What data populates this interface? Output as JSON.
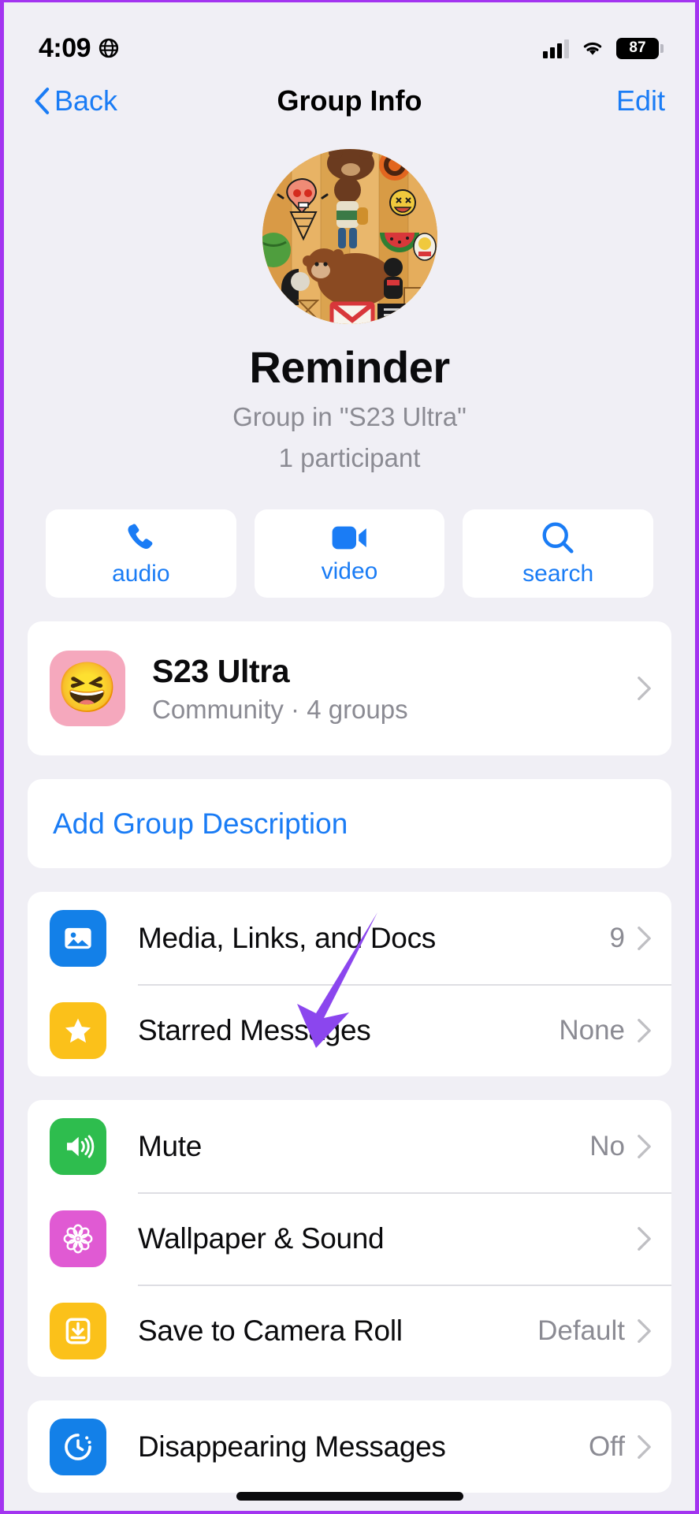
{
  "status_bar": {
    "time": "4:09",
    "location_icon": "globe-icon",
    "signal_icon": "cellular-signal-icon",
    "wifi_icon": "wifi-icon",
    "battery_level": "87"
  },
  "nav": {
    "back_label": "Back",
    "title": "Group Info",
    "edit_label": "Edit"
  },
  "profile": {
    "avatar_name": "group-avatar",
    "group_name": "Reminder",
    "parent_community": "Group in \"S23 Ultra\"",
    "participants": "1 participant"
  },
  "actions": [
    {
      "label": "audio",
      "icon": "phone-icon"
    },
    {
      "label": "video",
      "icon": "video-camera-icon"
    },
    {
      "label": "search",
      "icon": "search-icon"
    }
  ],
  "community": {
    "emoji": "😆",
    "title": "S23 Ultra",
    "subtitle": "Community · 4 groups",
    "icon_bg": "#f5a8bd"
  },
  "description": {
    "label": "Add Group Description"
  },
  "media_section": [
    {
      "label": "Media, Links, and Docs",
      "value": "9",
      "icon": "photo-icon",
      "icon_bg": "#1380e8"
    },
    {
      "label": "Starred Messages",
      "value": "None",
      "icon": "star-icon",
      "icon_bg": "#fbc11a"
    }
  ],
  "settings_section": [
    {
      "label": "Mute",
      "value": "No",
      "icon": "speaker-icon",
      "icon_bg": "#2ebd4e"
    },
    {
      "label": "Wallpaper & Sound",
      "value": "",
      "icon": "flower-icon",
      "icon_bg": "#e05ad3"
    },
    {
      "label": "Save to Camera Roll",
      "value": "Default",
      "icon": "download-icon",
      "icon_bg": "#fbc11a"
    }
  ],
  "privacy_section": [
    {
      "label": "Disappearing Messages",
      "value": "Off",
      "icon": "timer-icon",
      "icon_bg": "#1380e8"
    }
  ],
  "annotation": {
    "name": "arrow-annotation",
    "color": "#8b46ee",
    "points_to": "Wallpaper & Sound"
  },
  "colors": {
    "accent_blue": "#1a7cf5",
    "background": "#f0eff5",
    "card": "#ffffff",
    "secondary_text": "#8b8b93",
    "frame_border": "#a334f0"
  }
}
